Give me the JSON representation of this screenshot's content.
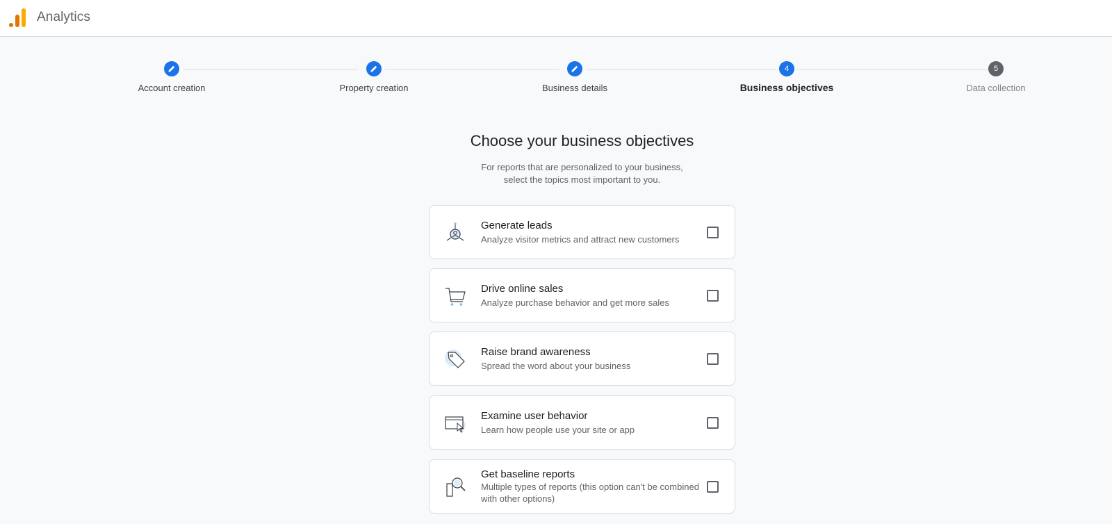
{
  "header": {
    "app_title": "Analytics",
    "logo_icon": "analytics-logo-icon"
  },
  "stepper": {
    "steps": [
      {
        "label": "Account creation",
        "state": "done",
        "marker": ""
      },
      {
        "label": "Property creation",
        "state": "done",
        "marker": ""
      },
      {
        "label": "Business details",
        "state": "done",
        "marker": ""
      },
      {
        "label": "Business objectives",
        "state": "active",
        "marker": "4"
      },
      {
        "label": "Data collection",
        "state": "pending",
        "marker": "5"
      }
    ]
  },
  "main": {
    "heading": "Choose your business objectives",
    "subtext_line1": "For reports that are personalized to your business,",
    "subtext_line2": "select the topics most important to you.",
    "objectives": [
      {
        "title": "Generate leads",
        "description": "Analyze visitor metrics and attract new customers",
        "icon": "leads-icon",
        "checked": false
      },
      {
        "title": "Drive online sales",
        "description": "Analyze purchase behavior and get more sales",
        "icon": "shopping-cart-icon",
        "checked": false
      },
      {
        "title": "Raise brand awareness",
        "description": "Spread the word about your business",
        "icon": "tag-icon",
        "checked": false
      },
      {
        "title": "Examine user behavior",
        "description": "Learn how people use your site or app",
        "icon": "cursor-window-icon",
        "checked": false
      },
      {
        "title": "Get baseline reports",
        "description": "Multiple types of reports (this option can't be combined with other options)",
        "icon": "magnifier-report-icon",
        "checked": false
      }
    ]
  },
  "colors": {
    "accent": "#1a73e8",
    "pending": "#5f6368",
    "logo_orange": "#f9ab00",
    "logo_dark_orange": "#e37400"
  }
}
